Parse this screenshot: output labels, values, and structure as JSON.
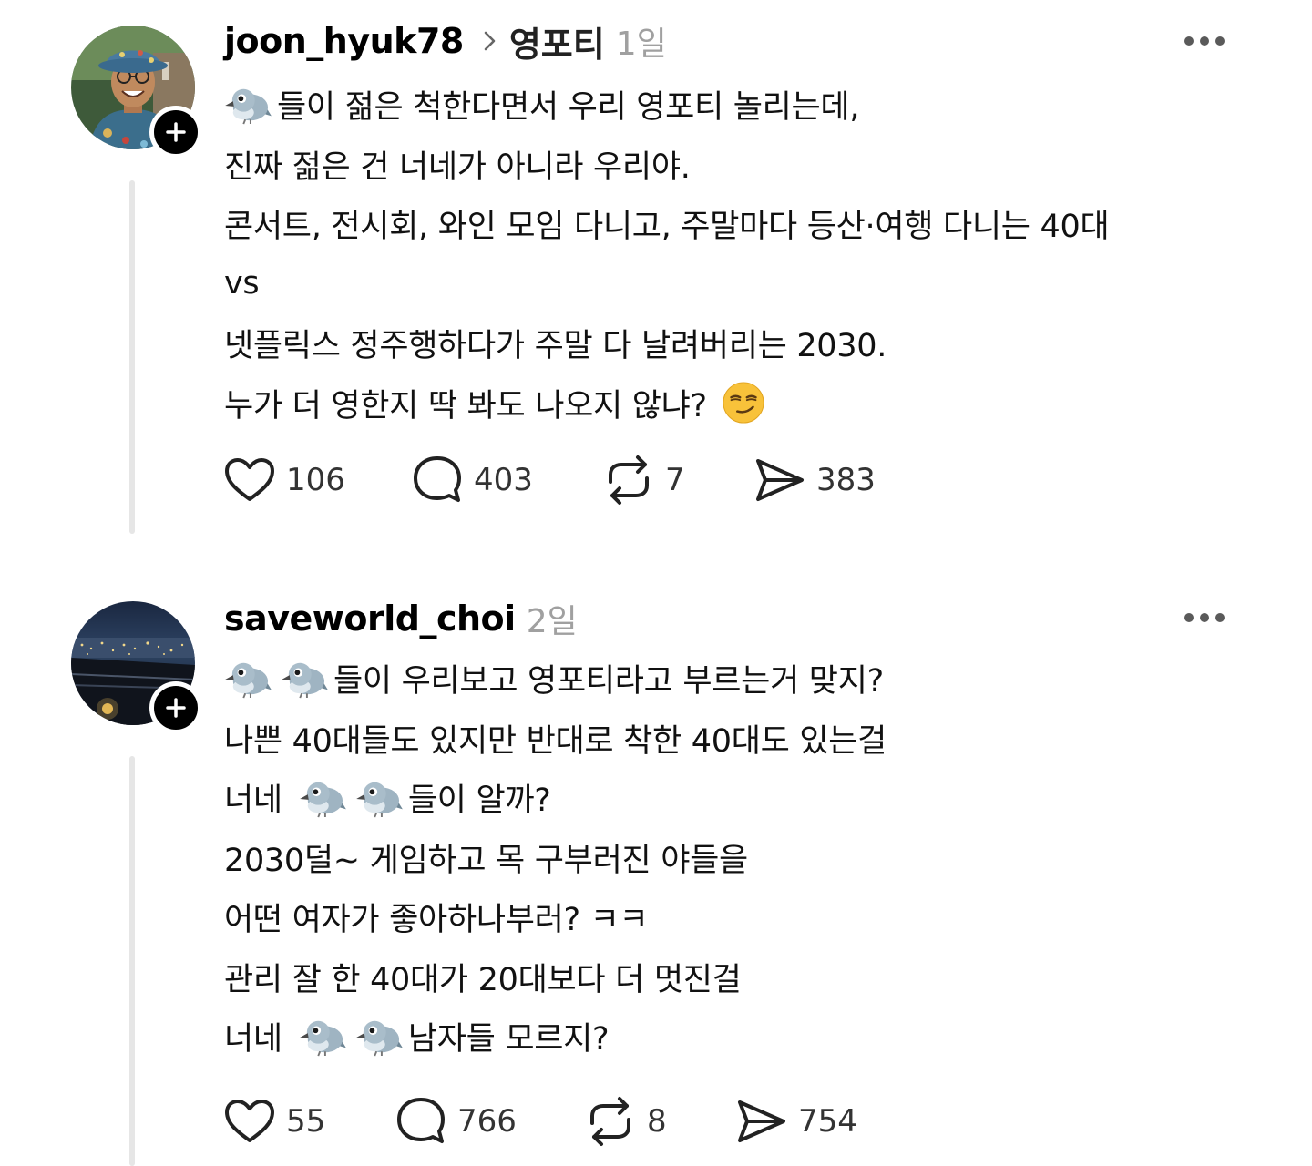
{
  "posts": [
    {
      "username": "joon_hyuk78",
      "topic": "영포티",
      "time": "1일",
      "lines": [
        "들이 젊은 척한다면서 우리 영포티 놀리는데,",
        "진짜 젊은 건 너네가 아니라 우리야.",
        "콘서트, 전시회, 와인 모임 다니고, 주말마다 등산·여행 다니는 40대",
        "vs",
        "넷플릭스 정주행하다가 주말 다 날려버리는 2030.",
        "누가 더 영한지 딱 봐도 나오지 않냐?"
      ],
      "emojis": {
        "bird": "🐦",
        "smirk": "😏"
      },
      "likes": "106",
      "comments": "403",
      "reposts": "7",
      "shares": "383"
    },
    {
      "username": "saveworld_choi",
      "time": "2일",
      "lines": [
        "들이 우리보고 영포티라고 부르는거 맞지?",
        "나쁜 40대들도 있지만 반대로 착한 40대도 있는걸",
        "너네",
        "들이 알까?",
        "2030덜~ 게임하고 목 구부러진 야들을",
        "어떤 여자가 좋아하나부러? ㅋㅋ",
        "관리 잘 한 40대가 20대보다 더 멋진걸",
        "너네",
        "남자들 모르지?"
      ],
      "likes": "55",
      "comments": "766",
      "reposts": "8",
      "shares": "754"
    }
  ],
  "icons": {
    "more": "more-horizontal-icon",
    "follow": "plus-icon",
    "like": "heart-icon",
    "comment": "speech-bubble-icon",
    "repost": "repost-icon",
    "share": "send-icon",
    "chevron": "chevron-right-icon",
    "bird": "bird-emoji",
    "smirk": "smirking-face-emoji"
  },
  "colors": {
    "text": "#000000",
    "muted": "#a0a0a0",
    "thread_line": "#e6e6e6",
    "follow_badge": "#000000"
  }
}
